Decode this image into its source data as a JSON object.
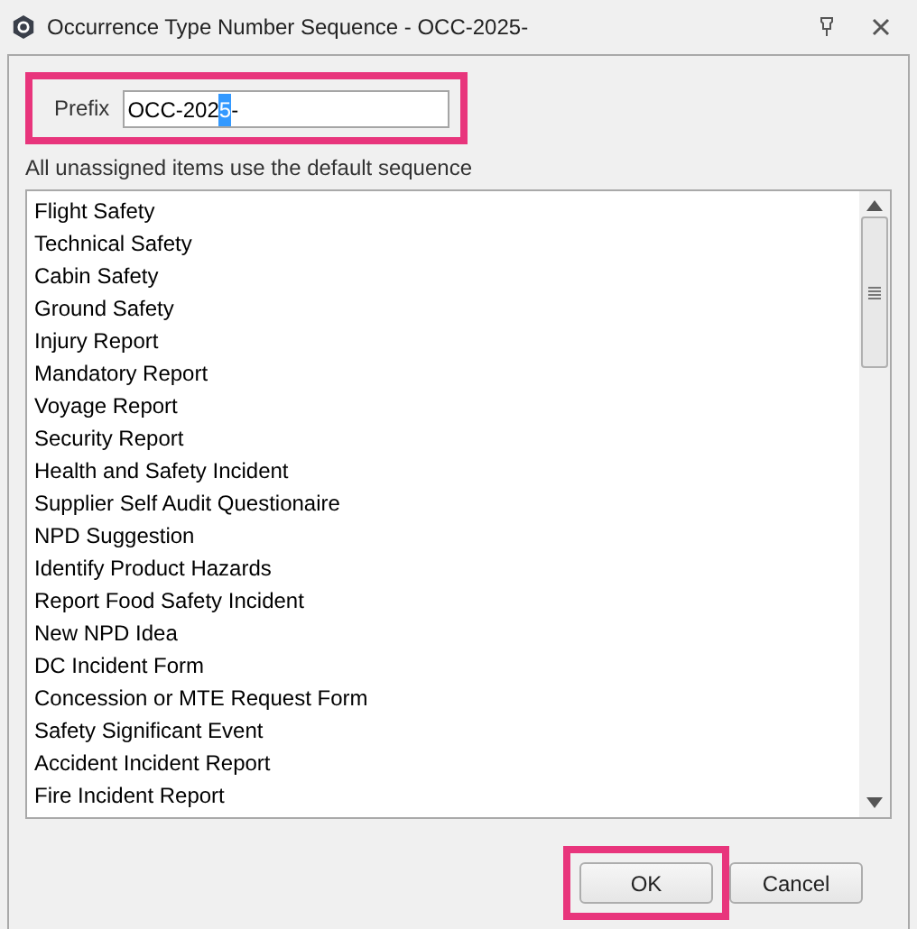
{
  "window": {
    "title": "Occurrence Type Number Sequence - OCC-2025-"
  },
  "prefix": {
    "label": "Prefix",
    "highlighted": true,
    "value_parts": [
      {
        "text": "OCC-202",
        "selected": false
      },
      {
        "text": "5",
        "selected": true
      },
      {
        "text": "-",
        "selected": false
      }
    ]
  },
  "hint": "All unassigned items use the default sequence",
  "items": [
    "Flight Safety",
    "Technical Safety",
    "Cabin Safety",
    "Ground Safety",
    "Injury Report",
    "Mandatory Report",
    "Voyage Report",
    "Security Report",
    "Health and Safety Incident",
    "Supplier Self Audit Questionaire",
    "NPD Suggestion",
    "Identify Product Hazards",
    "Report Food Safety Incident",
    "New NPD Idea",
    "DC Incident Form",
    "Concession or MTE Request Form",
    "Safety Significant Event",
    "Accident Incident Report",
    "Fire Incident Report"
  ],
  "buttons": [
    {
      "label": "OK",
      "highlighted": true
    },
    {
      "label": "Cancel",
      "highlighted": false
    }
  ]
}
